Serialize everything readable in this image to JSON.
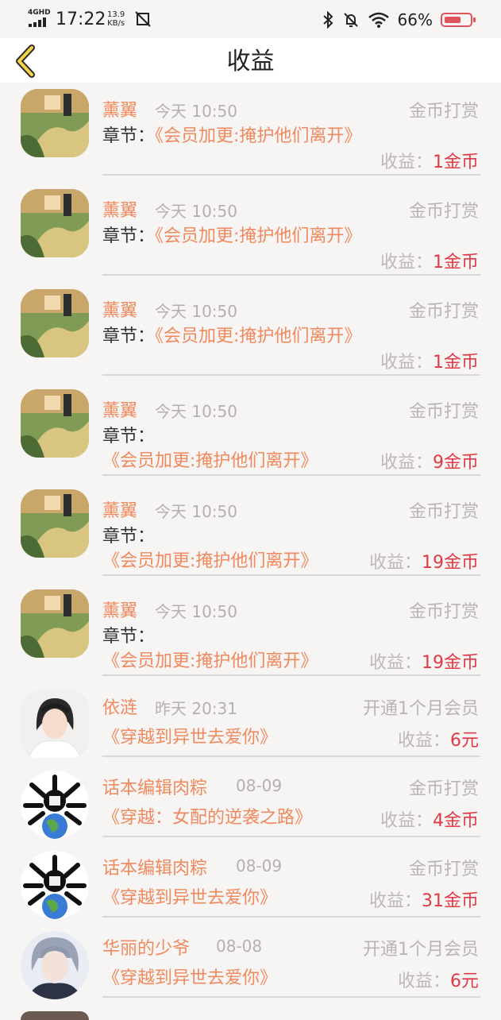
{
  "status_bar": {
    "network": "4GHD",
    "time": "17:22",
    "speed_value": "13.9",
    "speed_unit": "KB/s",
    "battery": "66%"
  },
  "header": {
    "title": "收益"
  },
  "items": [
    {
      "name": "薰翼",
      "time": "今天 10:50",
      "type": "金币打赏",
      "chapter_prefix": "章节：",
      "chapter": "《会员加更:掩护他们离开》",
      "earn_label": "收益：",
      "earn_value": "1金币",
      "avatar": "book-cover"
    },
    {
      "name": "薰翼",
      "time": "今天 10:50",
      "type": "金币打赏",
      "chapter_prefix": "章节：",
      "chapter": "《会员加更:掩护他们离开》",
      "earn_label": "收益：",
      "earn_value": "1金币",
      "avatar": "book-cover"
    },
    {
      "name": "薰翼",
      "time": "今天 10:50",
      "type": "金币打赏",
      "chapter_prefix": "章节：",
      "chapter": "《会员加更:掩护他们离开》",
      "earn_label": "收益：",
      "earn_value": "1金币",
      "avatar": "book-cover"
    },
    {
      "name": "薰翼",
      "time": "今天 10:50",
      "type": "金币打赏",
      "chapter_prefix": "章节：",
      "chapter": "《会员加更:掩护他们离开》",
      "earn_label": "收益：",
      "earn_value": "9金币",
      "avatar": "book-cover"
    },
    {
      "name": "薰翼",
      "time": "今天 10:50",
      "type": "金币打赏",
      "chapter_prefix": "章节：",
      "chapter": "《会员加更:掩护他们离开》",
      "earn_label": "收益：",
      "earn_value": "19金币",
      "avatar": "book-cover"
    },
    {
      "name": "薰翼",
      "time": "今天 10:50",
      "type": "金币打赏",
      "chapter_prefix": "章节：",
      "chapter": "《会员加更:掩护他们离开》",
      "earn_label": "收益：",
      "earn_value": "19金币",
      "avatar": "book-cover"
    },
    {
      "name": "依涟",
      "time": "昨天 20:31",
      "type": "开通1个月会员",
      "book": "《穿越到异世去爱你》",
      "earn_label": "收益：",
      "earn_value": "6元",
      "avatar": "girl-photo"
    },
    {
      "name": "话本编辑肉粽",
      "time": "08-09",
      "type": "金币打赏",
      "book": "《穿越：女配的逆袭之路》",
      "earn_label": "收益：",
      "earn_value": "4金币",
      "avatar": "meme-earth"
    },
    {
      "name": "话本编辑肉粽",
      "time": "08-09",
      "type": "金币打赏",
      "book": "《穿越到异世去爱你》",
      "earn_label": "收益：",
      "earn_value": "31金币",
      "avatar": "meme-earth"
    },
    {
      "name": "华丽的少爷",
      "time": "08-08",
      "type": "开通1个月会员",
      "book": "《穿越到异世去爱你》",
      "earn_label": "收益：",
      "earn_value": "6元",
      "avatar": "anime-boy"
    }
  ]
}
